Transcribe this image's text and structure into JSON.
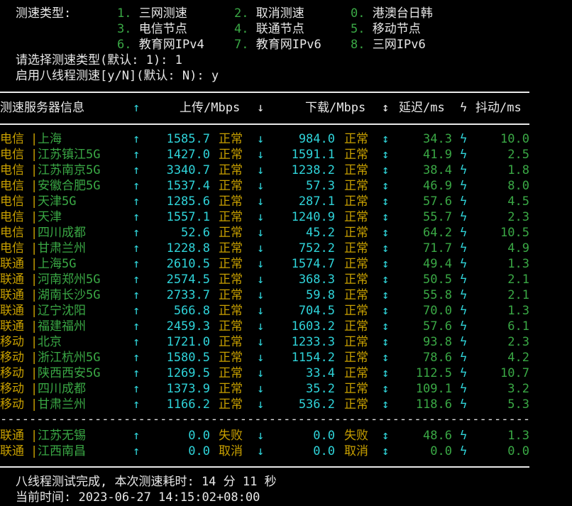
{
  "menu": {
    "label": "测速类型:",
    "options": [
      {
        "num": "1.",
        "text": "三网测速"
      },
      {
        "num": "2.",
        "text": "取消测速"
      },
      {
        "num": "0.",
        "text": "港澳台日韩"
      },
      {
        "num": "3.",
        "text": "电信节点"
      },
      {
        "num": "4.",
        "text": "联通节点"
      },
      {
        "num": "5.",
        "text": "移动节点"
      },
      {
        "num": "6.",
        "text": "教育网IPv4"
      },
      {
        "num": "7.",
        "text": "教育网IPv6"
      },
      {
        "num": "8.",
        "text": "三网IPv6"
      }
    ]
  },
  "prompts": {
    "type_prompt": "请选择测速类型(默认: 1): 1",
    "thread_prompt": "启用八线程测速[y/N](默认: N): y"
  },
  "header": {
    "server": "测速服务器信息",
    "up_arrow": "↑",
    "upload": "上传/Mbps",
    "down_arrow": "↓",
    "download": "下载/Mbps",
    "updown": "↕",
    "latency": "延迟/ms",
    "bolt": "ϟ",
    "jitter": "抖动/ms"
  },
  "rows": [
    {
      "isp": "电信",
      "loc": "上海",
      "up": "1585.7",
      "us": "正常",
      "down": "984.0",
      "ds": "正常",
      "lat": "34.3",
      "jit": "10.0"
    },
    {
      "isp": "电信",
      "loc": "江苏镇江5G",
      "up": "1427.0",
      "us": "正常",
      "down": "1591.1",
      "ds": "正常",
      "lat": "41.9",
      "jit": "2.5"
    },
    {
      "isp": "电信",
      "loc": "江苏南京5G",
      "up": "3340.7",
      "us": "正常",
      "down": "1238.2",
      "ds": "正常",
      "lat": "38.4",
      "jit": "1.8"
    },
    {
      "isp": "电信",
      "loc": "安徽合肥5G",
      "up": "1537.4",
      "us": "正常",
      "down": "57.3",
      "ds": "正常",
      "lat": "46.9",
      "jit": "8.0"
    },
    {
      "isp": "电信",
      "loc": "天津5G",
      "up": "1285.6",
      "us": "正常",
      "down": "287.1",
      "ds": "正常",
      "lat": "57.6",
      "jit": "4.5"
    },
    {
      "isp": "电信",
      "loc": "天津",
      "up": "1557.1",
      "us": "正常",
      "down": "1240.9",
      "ds": "正常",
      "lat": "55.7",
      "jit": "2.3"
    },
    {
      "isp": "电信",
      "loc": "四川成都",
      "up": "52.6",
      "us": "正常",
      "down": "45.2",
      "ds": "正常",
      "lat": "64.2",
      "jit": "10.5"
    },
    {
      "isp": "电信",
      "loc": "甘肃兰州",
      "up": "1228.8",
      "us": "正常",
      "down": "752.2",
      "ds": "正常",
      "lat": "71.7",
      "jit": "4.9"
    },
    {
      "isp": "联通",
      "loc": "上海5G",
      "up": "2610.5",
      "us": "正常",
      "down": "1574.7",
      "ds": "正常",
      "lat": "49.4",
      "jit": "1.3"
    },
    {
      "isp": "联通",
      "loc": "河南郑州5G",
      "up": "2574.5",
      "us": "正常",
      "down": "368.3",
      "ds": "正常",
      "lat": "50.5",
      "jit": "2.1"
    },
    {
      "isp": "联通",
      "loc": "湖南长沙5G",
      "up": "2733.7",
      "us": "正常",
      "down": "59.8",
      "ds": "正常",
      "lat": "55.8",
      "jit": "2.1"
    },
    {
      "isp": "联通",
      "loc": "辽宁沈阳",
      "up": "566.8",
      "us": "正常",
      "down": "704.5",
      "ds": "正常",
      "lat": "70.0",
      "jit": "1.3"
    },
    {
      "isp": "联通",
      "loc": "福建福州",
      "up": "2459.3",
      "us": "正常",
      "down": "1603.2",
      "ds": "正常",
      "lat": "57.6",
      "jit": "6.1"
    },
    {
      "isp": "移动",
      "loc": "北京",
      "up": "1721.0",
      "us": "正常",
      "down": "1233.3",
      "ds": "正常",
      "lat": "93.8",
      "jit": "2.3"
    },
    {
      "isp": "移动",
      "loc": "浙江杭州5G",
      "up": "1580.5",
      "us": "正常",
      "down": "1154.2",
      "ds": "正常",
      "lat": "78.6",
      "jit": "4.2"
    },
    {
      "isp": "移动",
      "loc": "陕西西安5G",
      "up": "1269.5",
      "us": "正常",
      "down": "33.4",
      "ds": "正常",
      "lat": "112.5",
      "jit": "10.7"
    },
    {
      "isp": "移动",
      "loc": "四川成都",
      "up": "1373.9",
      "us": "正常",
      "down": "35.2",
      "ds": "正常",
      "lat": "109.1",
      "jit": "3.2"
    },
    {
      "isp": "移动",
      "loc": "甘肃兰州",
      "up": "1166.2",
      "us": "正常",
      "down": "536.2",
      "ds": "正常",
      "lat": "118.6",
      "jit": "5.3"
    }
  ],
  "extra_rows": [
    {
      "isp": "联通",
      "loc": "江苏无锡",
      "up": "0.0",
      "us": "失败",
      "down": "0.0",
      "ds": "失败",
      "lat": "48.6",
      "jit": "1.3"
    },
    {
      "isp": "联通",
      "loc": "江西南昌",
      "up": "0.0",
      "us": "取消",
      "down": "0.0",
      "ds": "取消",
      "lat": "0.0",
      "jit": "0.0"
    }
  ],
  "dash_line": "------------------------------------------------------------------------------------------",
  "footer": {
    "done": "八线程测试完成, 本次测速耗时: 14 分 11 秒",
    "time": "当前时间: 2023-06-27 14:15:02+08:00"
  },
  "colors": {
    "yellow": "#c8a000",
    "green": "#3aa845",
    "cyan": "#2fd3d9",
    "white": "#e8e8e8",
    "bg": "#000000"
  }
}
